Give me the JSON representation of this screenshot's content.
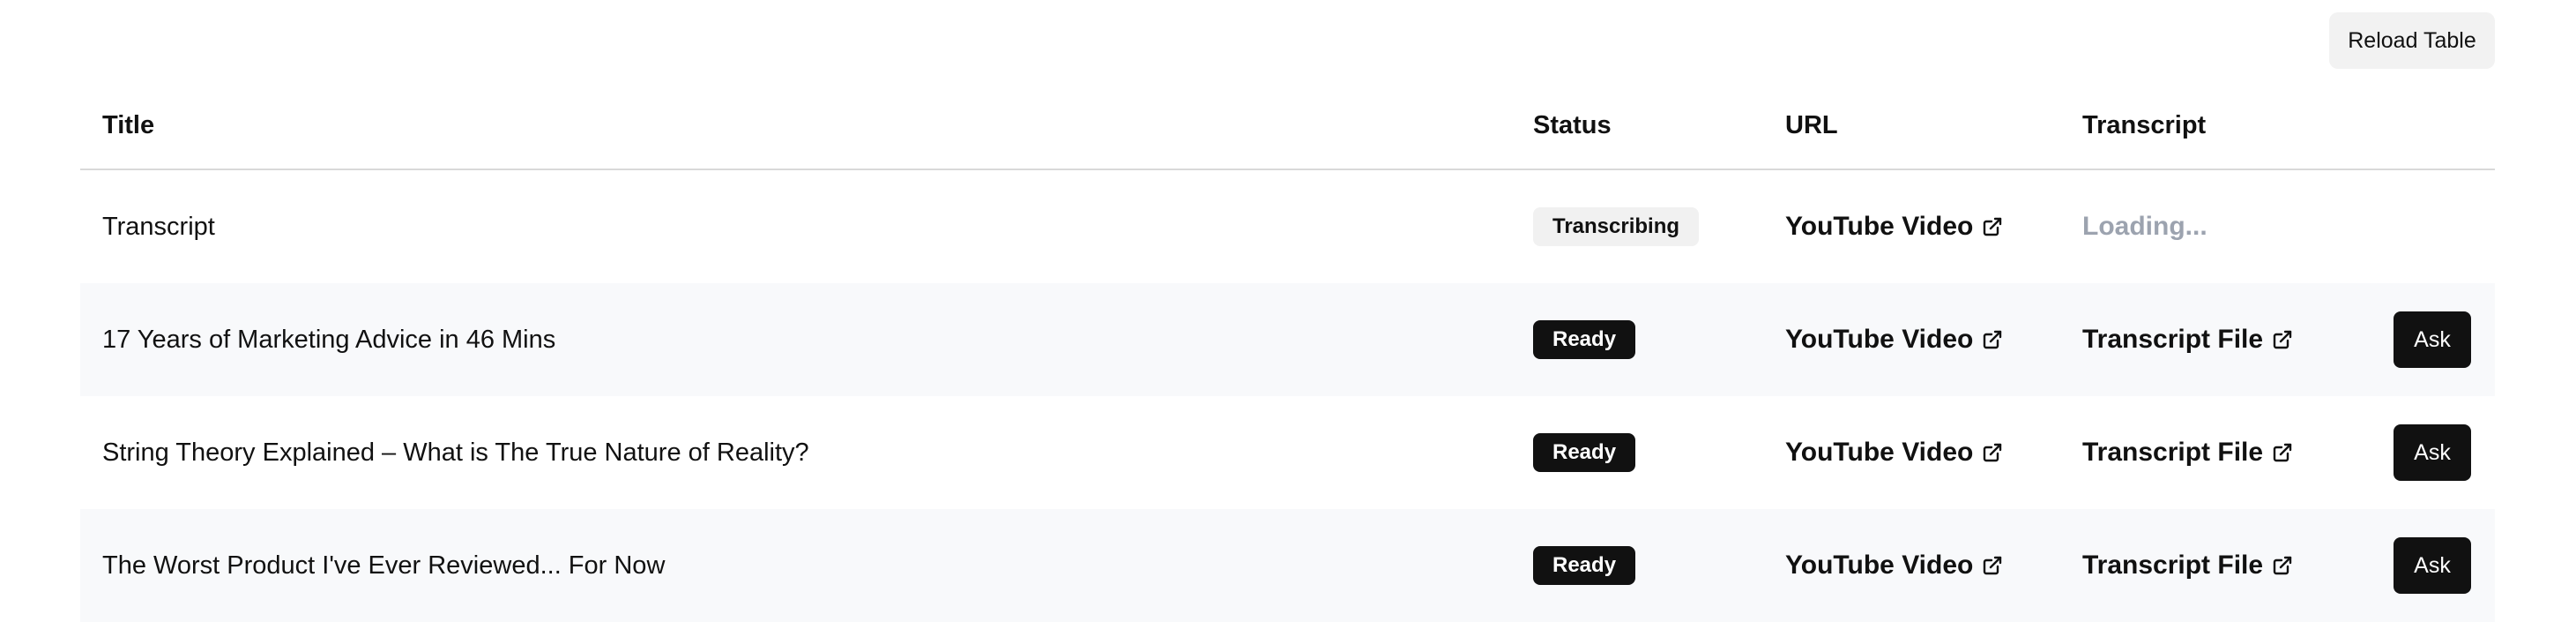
{
  "toolbar": {
    "reload_label": "Reload Table"
  },
  "table": {
    "headers": {
      "title": "Title",
      "status": "Status",
      "url": "URL",
      "transcript": "Transcript"
    },
    "rows": [
      {
        "title": "Transcript",
        "status": "Transcribing",
        "url_label": "YouTube Video",
        "transcript_label": "Loading...",
        "transcript_state": "loading",
        "ask_label": ""
      },
      {
        "title": "17 Years of Marketing Advice in 46 Mins",
        "status": "Ready",
        "url_label": "YouTube Video",
        "transcript_label": "Transcript File",
        "transcript_state": "ready",
        "ask_label": "Ask"
      },
      {
        "title": "String Theory Explained – What is The True Nature of Reality?",
        "status": "Ready",
        "url_label": "YouTube Video",
        "transcript_label": "Transcript File",
        "transcript_state": "ready",
        "ask_label": "Ask"
      },
      {
        "title": "The Worst Product I've Ever Reviewed... For Now",
        "status": "Ready",
        "url_label": "YouTube Video",
        "transcript_label": "Transcript File",
        "transcript_state": "ready",
        "ask_label": "Ask"
      }
    ]
  },
  "icons": {
    "external_link": "external-link-icon"
  },
  "colors": {
    "badge_ready_bg": "#111111",
    "badge_transcribing_bg": "#f1f1f1",
    "loading_text": "#9ca3af",
    "alt_row_bg": "#f8f9fb",
    "ask_button_bg": "#111111"
  }
}
